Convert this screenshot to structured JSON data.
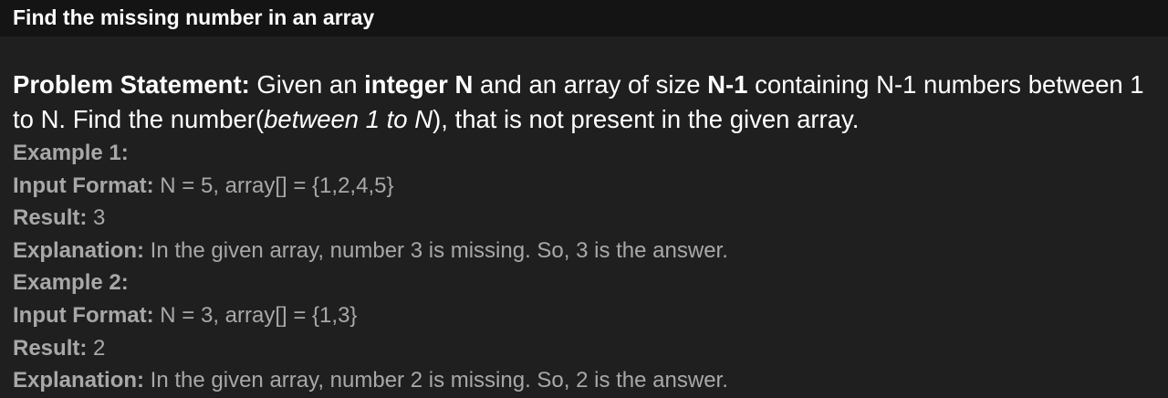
{
  "title": "Find the missing number in an array",
  "statement": {
    "label": "Problem Statement:",
    "t1": " Given an ",
    "b1": "integer N",
    "t2": " and an array of size ",
    "b2": "N-1",
    "t3": " containing N-1 numbers between 1 to N. Find the number(",
    "i1": "between 1 to N",
    "t4": "), that is not present in the given array."
  },
  "examples": [
    {
      "heading": "Example 1:",
      "input_label": "Input Format:",
      "input_value": " N = 5, array[] = {1,2,4,5}",
      "result_label": "Result:",
      "result_value": " 3",
      "explanation_label": "Explanation:",
      "explanation_value": " In the given array, number 3 is missing. So, 3 is the answer."
    },
    {
      "heading": "Example 2:",
      "input_label": "Input Format:",
      "input_value": " N = 3, array[] = {1,3}",
      "result_label": "Result:",
      "result_value": " 2",
      "explanation_label": "Explanation:",
      "explanation_value": " In the given array, number 2 is missing. So, 2 is the answer."
    }
  ]
}
